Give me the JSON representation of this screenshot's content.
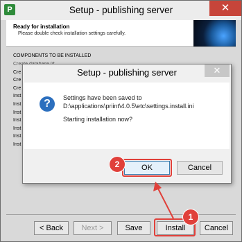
{
  "window": {
    "title": "Setup - publishing server",
    "app_icon": "P",
    "close_glyph": "✕"
  },
  "header": {
    "title": "Ready for installation",
    "subtitle": "Please double check installation settings carefully."
  },
  "components": {
    "heading": "COMPONENTS TO BE INSTALLED",
    "items": [
      "Create database (if not existing)",
      "Cre",
      "Cre",
      "Cre",
      "Inst",
      "Inst",
      "Inst",
      "Inst",
      "Inst",
      "Inst",
      "Inst"
    ]
  },
  "footer": {
    "back": "< Back",
    "next": "Next >",
    "save": "Save",
    "install": "Install",
    "cancel": "Cancel"
  },
  "dialog": {
    "title": "Setup - publishing server",
    "close_glyph": "✕",
    "icon": "?",
    "message_line1": "Settings have been saved to",
    "message_line2": "D:\\applications\\priint\\4.0.5\\etc\\settings.install.ini",
    "question": "Starting installation now?",
    "ok": "OK",
    "cancel": "Cancel"
  },
  "annotations": {
    "badge1": "1",
    "badge2": "2",
    "color": "#e0403a"
  }
}
